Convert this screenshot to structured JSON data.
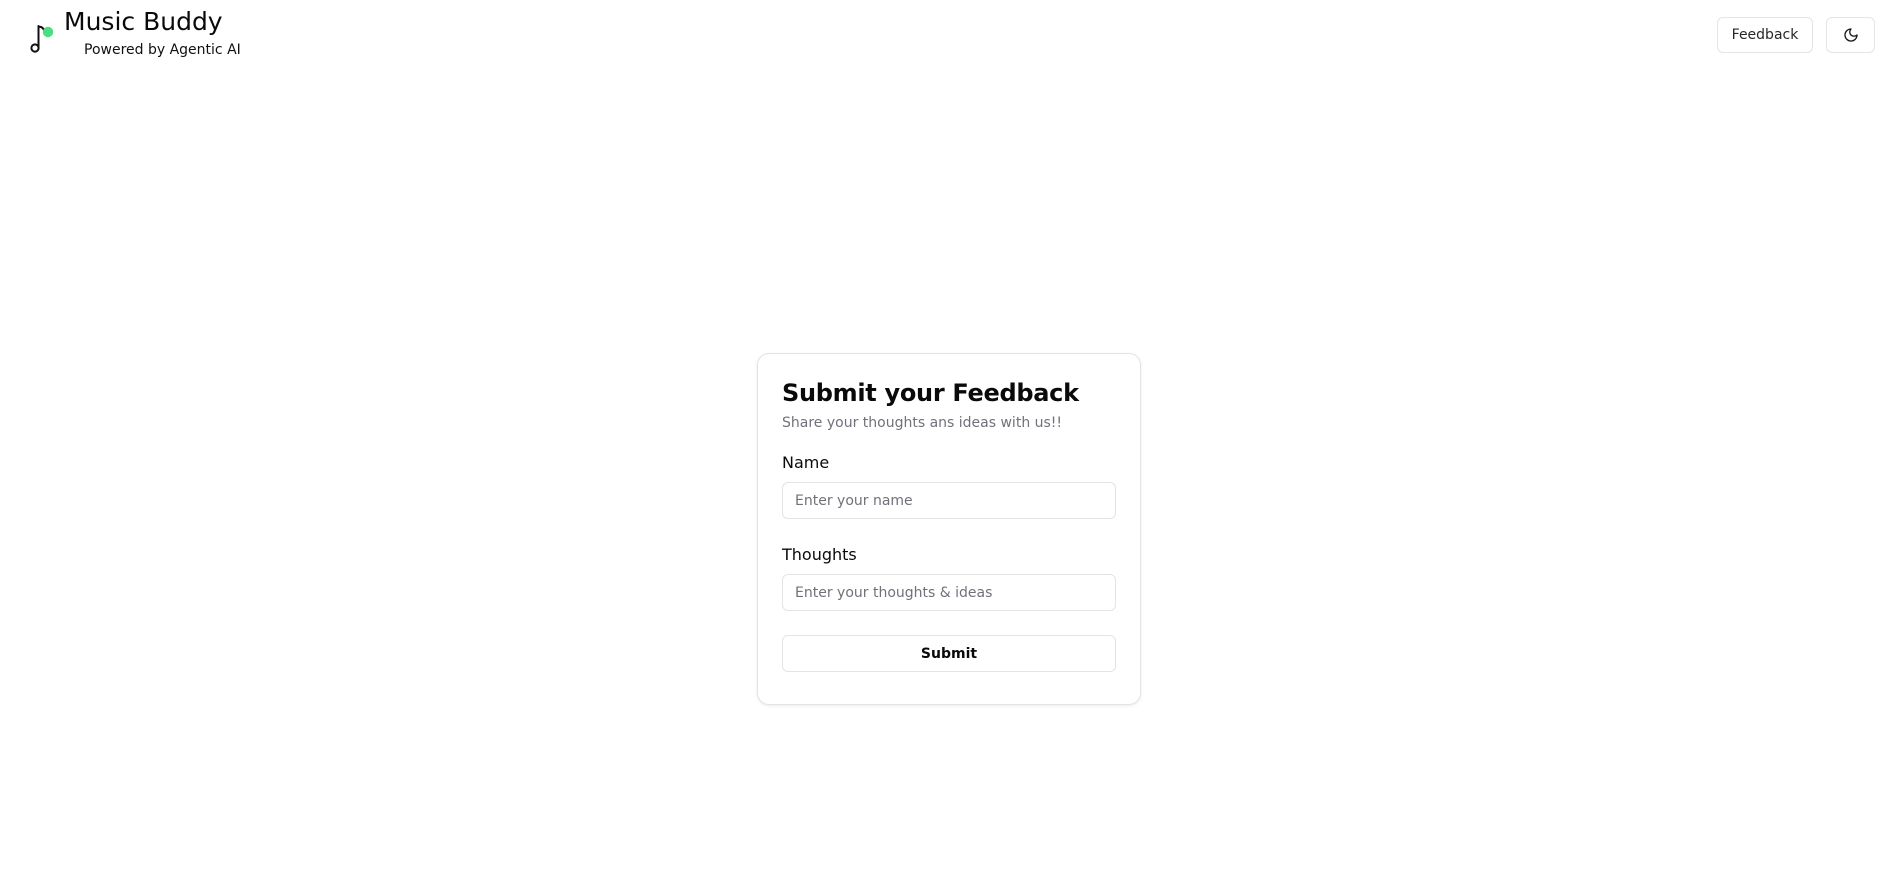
{
  "app": {
    "title": "Music Buddy",
    "subtitle": "Powered by Agentic AI",
    "logo_icon": "music-note-icon",
    "accent_color": "#4ade80"
  },
  "header": {
    "feedback_label": "Feedback",
    "theme_toggle_icon": "moon-icon"
  },
  "form": {
    "title": "Submit your Feedback",
    "description": "Share your thoughts ans ideas with us!!",
    "name_label": "Name",
    "name_placeholder": "Enter your name",
    "name_value": "",
    "thoughts_label": "Thoughts",
    "thoughts_placeholder": "Enter your thoughts & ideas",
    "thoughts_value": "",
    "submit_label": "Submit"
  }
}
